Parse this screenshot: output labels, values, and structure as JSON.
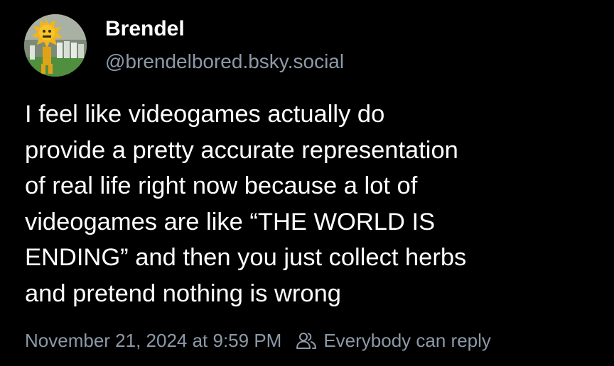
{
  "post": {
    "author": {
      "display_name": "Brendel",
      "handle": "@brendelbored.bsky.social",
      "avatar_icon": "avatar-image"
    },
    "text_lines": [
      "I feel like videogames actually do",
      "provide a pretty accurate representation",
      "of real life right now because a lot of",
      "videogames are like “THE WORLD IS",
      "ENDING” and then you just collect herbs",
      "and pretend nothing is wrong"
    ],
    "timestamp": "November 21, 2024 at 9:59 PM",
    "reply_setting": {
      "icon": "people-icon",
      "label": "Everybody can reply"
    }
  },
  "colors": {
    "background": "#000000",
    "primary_text": "#ffffff",
    "secondary_text": "#8d99a8"
  }
}
